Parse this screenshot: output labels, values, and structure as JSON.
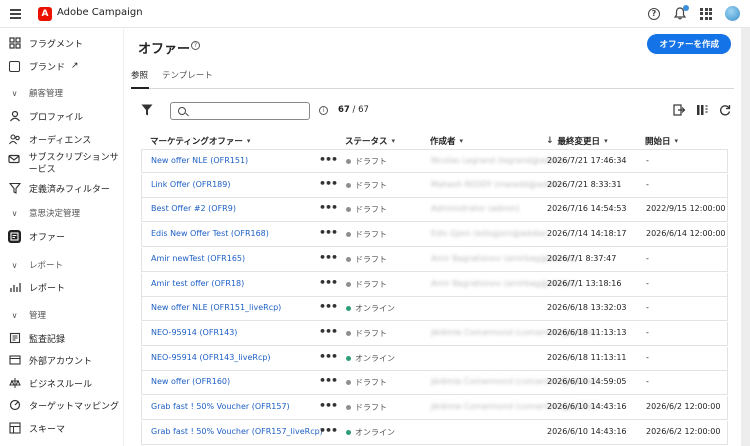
{
  "app": {
    "title": "Adobe Campaign"
  },
  "sidebar": {
    "fragment": "フラグメント",
    "brand": "ブランド",
    "section_customer": "顧客管理",
    "profile": "プロファイル",
    "audience": "オーディエンス",
    "subscription": "サブスクリプションサービス",
    "filters": "定義済みフィルター",
    "section_decision": "意思決定管理",
    "offers": "オファー",
    "section_reports": "レポート",
    "reports": "レポート",
    "section_admin": "管理",
    "audit": "監査記録",
    "external": "外部アカウント",
    "business_rules": "ビジネスルール",
    "target_mapping": "ターゲットマッピング",
    "schema": "スキーマ"
  },
  "page": {
    "title": "オファー",
    "create_button": "オファーを作成",
    "tabs": [
      "参照",
      "テンプレート"
    ],
    "count_shown": "67",
    "count_sep": " / ",
    "count_total": "67",
    "search_placeholder": ""
  },
  "table": {
    "headers": {
      "name": "マーケティングオファー",
      "status": "ステータス",
      "author": "作成者",
      "modified": "最終変更日",
      "start": "開始日"
    },
    "status_colors": {
      "draft": "#8e8e8e",
      "online": "#2d9d78"
    },
    "rows": [
      {
        "name": "New offer NLE (OFR151)",
        "status": "ドラフト",
        "status_type": "draft",
        "author": "Nicolas Legrand (legrand@adobe)",
        "modified": "2026/7/21 17:46:34",
        "start": "-"
      },
      {
        "name": "Link Offer (OFR189)",
        "status": "ドラフト",
        "status_type": "draft",
        "author": "Mahesh REDDY (maredd@adobe)",
        "modified": "2026/7/21 8:33:31",
        "start": "-"
      },
      {
        "name": "Best Offer #2 (OFR9)",
        "status": "ドラフト",
        "status_type": "draft",
        "author": "Administrator (admin)",
        "modified": "2026/7/16 14:54:53",
        "start": "2022/9/15 12:00:00"
      },
      {
        "name": "Edis New Offer Test (OFR168)",
        "status": "ドラフト",
        "status_type": "draft",
        "author": "Edis Gjoni (edisgjoni@adobe)",
        "modified": "2026/7/14 14:18:17",
        "start": "2026/6/14 12:00:00"
      },
      {
        "name": "Amir newTest (OFR165)",
        "status": "ドラフト",
        "status_type": "draft",
        "author": "Amir Bagrationov (amirbag@adobe)",
        "modified": "2026/7/1 8:37:47",
        "start": "-"
      },
      {
        "name": "Amir test offer (OFR18)",
        "status": "ドラフト",
        "status_type": "draft",
        "author": "Amir Bagrationov (amirbag@adobe)",
        "modified": "2026/7/1 13:18:16",
        "start": "-"
      },
      {
        "name": "New offer NLE (OFR151_liveRcp)",
        "status": "オンライン",
        "status_type": "online",
        "author": "",
        "modified": "2026/6/18 13:32:03",
        "start": "-"
      },
      {
        "name": "NEO-95914 (OFR143)",
        "status": "ドラフト",
        "status_type": "draft",
        "author": "Jérémie Comarmond (comarmon@adobe)",
        "modified": "2026/6/18 11:13:13",
        "start": "-"
      },
      {
        "name": "NEO-95914 (OFR143_liveRcp)",
        "status": "オンライン",
        "status_type": "online",
        "author": "",
        "modified": "2026/6/18 11:13:11",
        "start": "-"
      },
      {
        "name": "New offer (OFR160)",
        "status": "ドラフト",
        "status_type": "draft",
        "author": "Jérémie Comarmond (comarmon@adobe)",
        "modified": "2026/6/10 14:59:05",
        "start": "-"
      },
      {
        "name": "Grab fast ! 50% Voucher (OFR157)",
        "status": "ドラフト",
        "status_type": "draft",
        "author": "Jérémie Comarmond (comarmon@adobe)",
        "modified": "2026/6/10 14:43:16",
        "start": "2026/6/2 12:00:00"
      },
      {
        "name": "Grab fast ! 50% Voucher (OFR157_liveRcp)",
        "status": "オンライン",
        "status_type": "online",
        "author": "",
        "modified": "2026/6/10 14:43:16",
        "start": "2026/6/2 12:00:00"
      }
    ]
  }
}
